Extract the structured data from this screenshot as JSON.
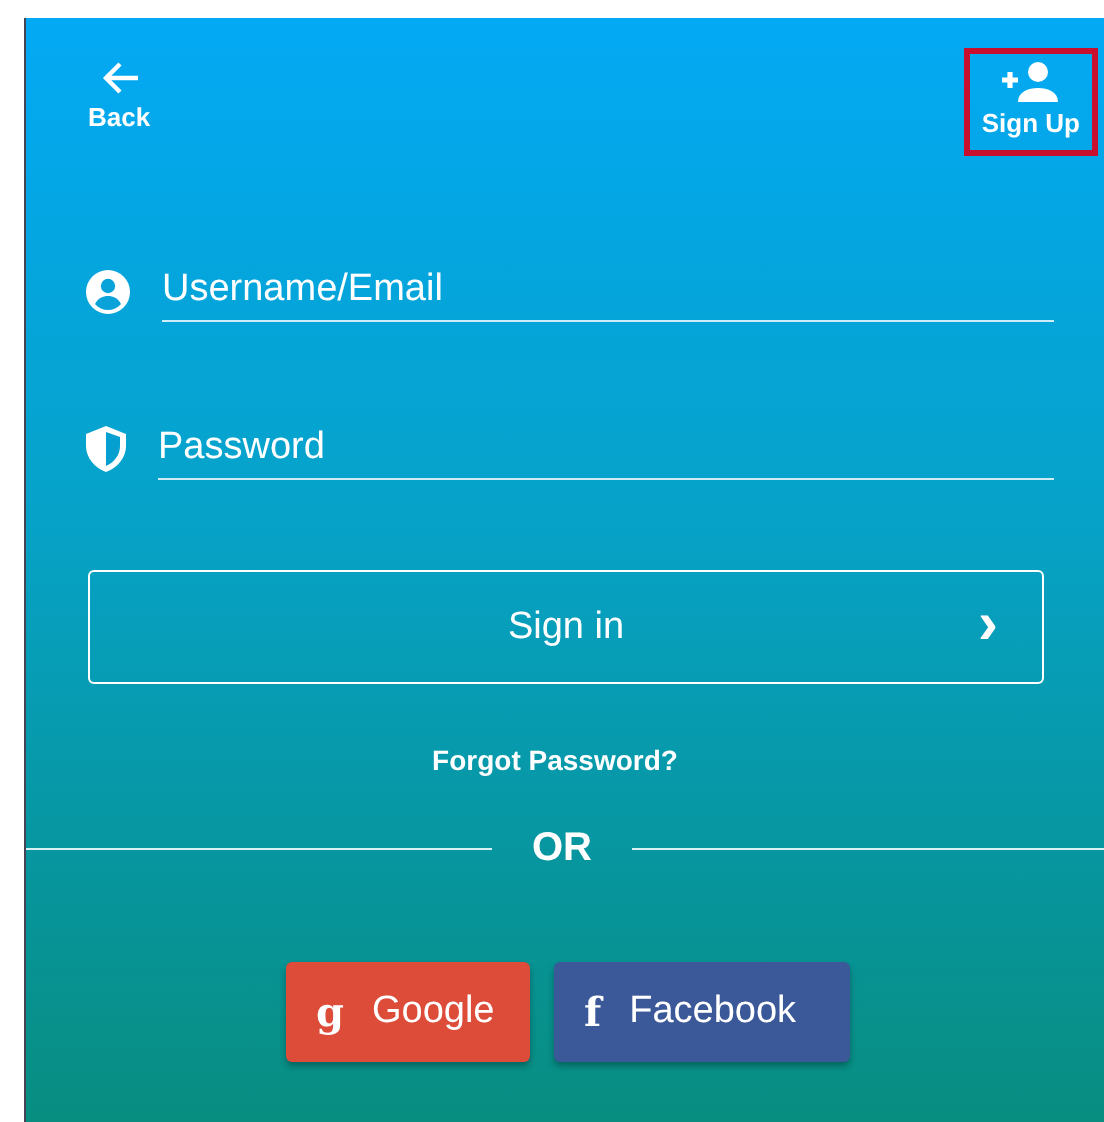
{
  "header": {
    "back": {
      "label": "Back"
    },
    "sign_up": {
      "label": "Sign Up",
      "highlighted": true
    }
  },
  "fields": [
    {
      "kind": "user",
      "placeholder": "Username/Email"
    },
    {
      "kind": "password",
      "placeholder": "Password"
    }
  ],
  "sign_in": {
    "label": "Sign in",
    "chevron": "›"
  },
  "forgot_password": "Forgot Password?",
  "divider": "OR",
  "social": [
    {
      "kind": "google",
      "icon": "g",
      "label": "Google"
    },
    {
      "kind": "facebook",
      "icon": "f",
      "label": "Facebook"
    }
  ]
}
